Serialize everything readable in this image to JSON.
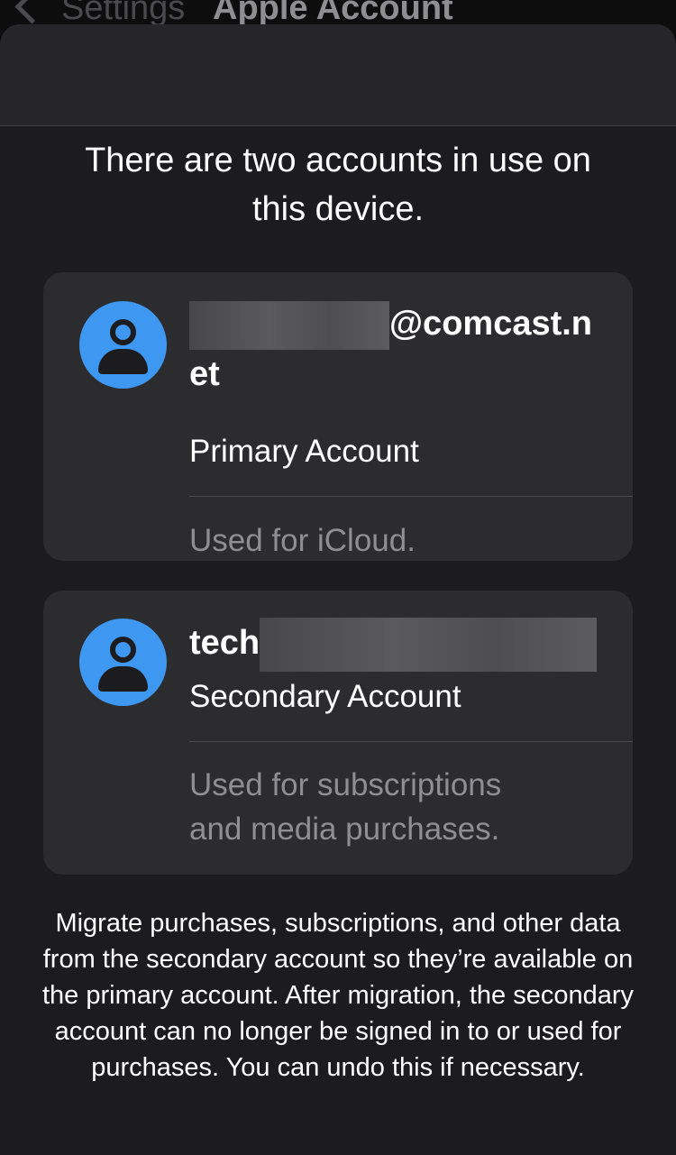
{
  "background_nav": {
    "back_label": "Settings",
    "title": "Apple Account"
  },
  "sheet": {
    "headline": "There are two accounts in use on this device."
  },
  "primary_account": {
    "email_suffix": "@comcast.n",
    "email_suffix_wrap": "et",
    "role": "Primary Account",
    "usage": "Used for iCloud."
  },
  "secondary_account": {
    "email_prefix": "tech",
    "role": "Secondary Account",
    "usage_line1": "Used for subscriptions",
    "usage_line2": "and media purchases."
  },
  "footer": {
    "description": "Migrate purchases, subscriptions, and other data from the secondary account so they’re available on the primary account. After migration, the secondary account can no longer be signed in to or used for purchases. You can undo this if necessary."
  },
  "colors": {
    "accent_avatar": "#3e97f1",
    "sheet_bg": "#1c1c1e",
    "card_bg": "#2c2c2e",
    "secondary_text": "#8e8e93"
  },
  "icons": {
    "avatar": "person-icon",
    "back": "chevron-left-icon"
  }
}
